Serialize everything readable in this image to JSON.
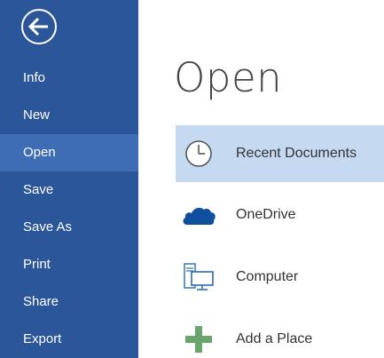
{
  "sidebar": {
    "background": "#2b579a",
    "selected_background": "#3e6db5",
    "back_icon": "back-arrow-icon",
    "items": [
      {
        "label": "Info"
      },
      {
        "label": "New"
      },
      {
        "label": "Open",
        "selected": true
      },
      {
        "label": "Save"
      },
      {
        "label": "Save As"
      },
      {
        "label": "Print"
      },
      {
        "label": "Share"
      },
      {
        "label": "Export"
      }
    ]
  },
  "main": {
    "title": "Open",
    "places": [
      {
        "label": "Recent Documents",
        "icon": "clock-icon",
        "selected": true
      },
      {
        "label": "OneDrive",
        "icon": "cloud-icon"
      },
      {
        "label": "Computer",
        "icon": "computer-icon"
      },
      {
        "label": "Add a Place",
        "icon": "plus-icon"
      }
    ],
    "selected_place_background": "#c5d9f1"
  }
}
